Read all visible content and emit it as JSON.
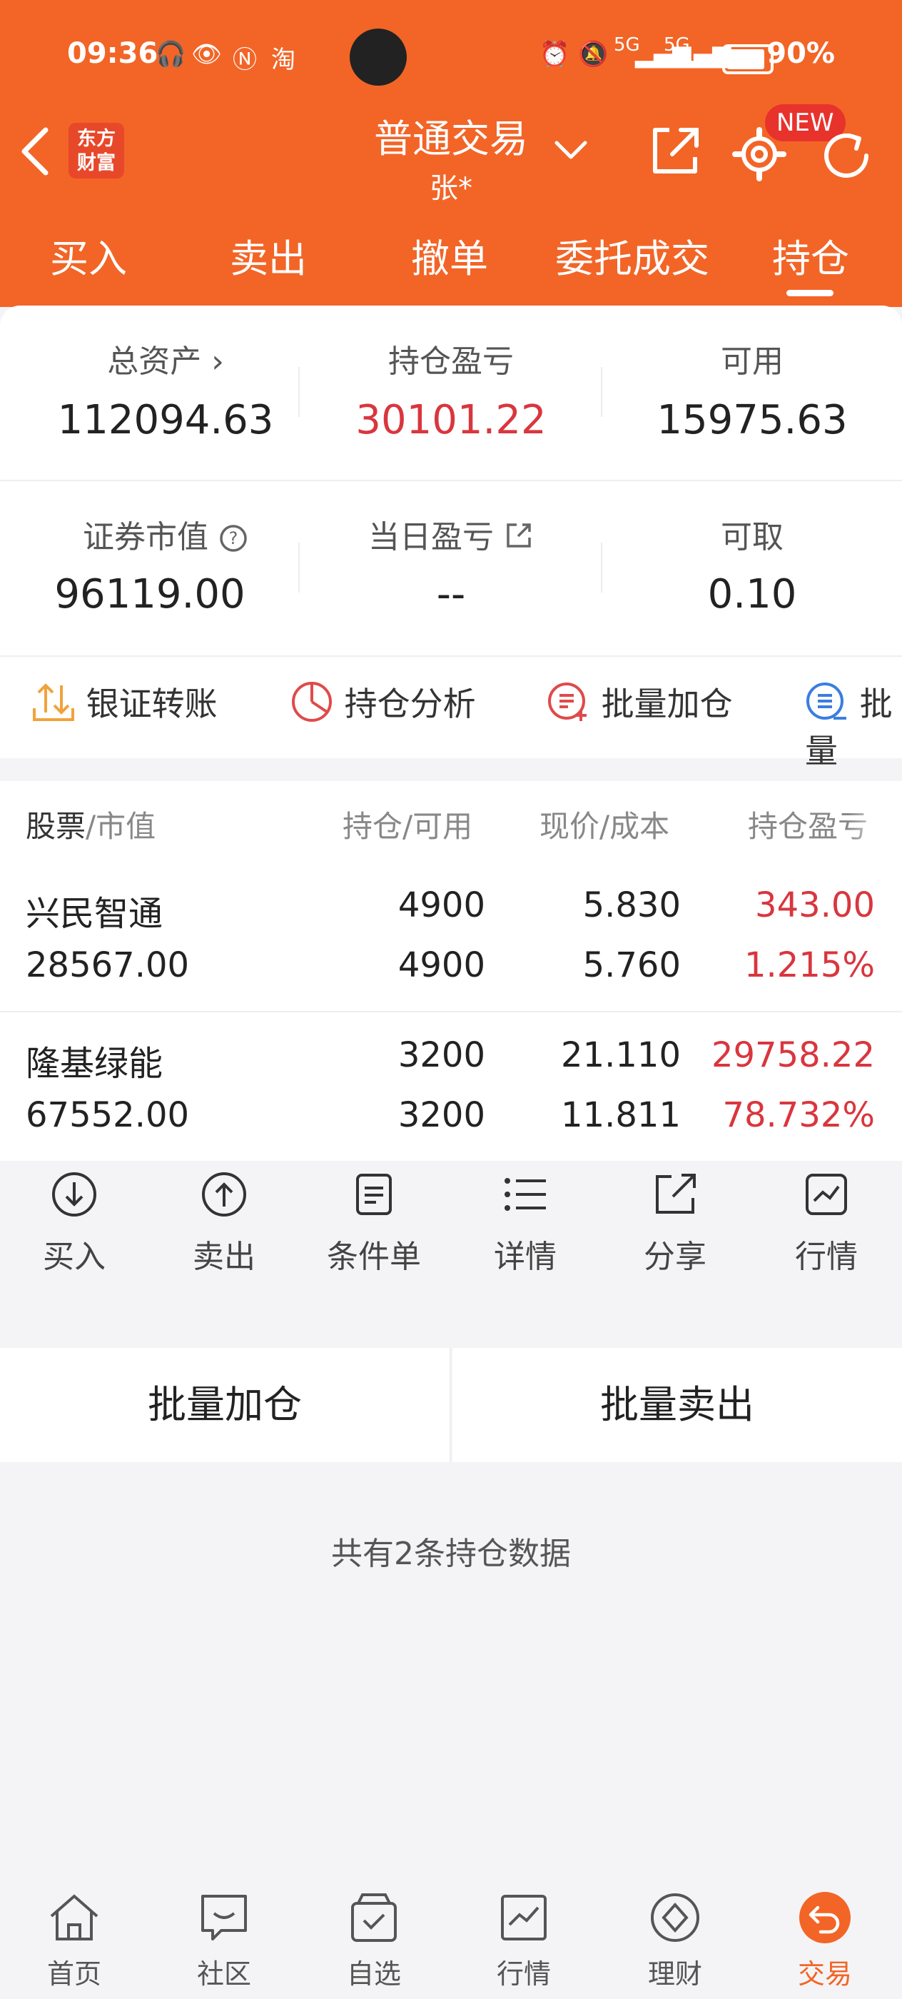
{
  "status_bar": {
    "time": "09:36",
    "battery": "90%",
    "network1": "5G",
    "network2": "5G"
  },
  "navbar": {
    "logo_line1": "东方",
    "logo_line2": "财富",
    "title": "普通交易",
    "subtitle": "张*",
    "badge": "NEW"
  },
  "tabs": [
    {
      "label": "买入"
    },
    {
      "label": "卖出"
    },
    {
      "label": "撤单"
    },
    {
      "label": "委托成交"
    },
    {
      "label": "持仓"
    }
  ],
  "summary": {
    "total_assets_label": "总资产",
    "total_assets": "112094.63",
    "position_pnl_label": "持仓盈亏",
    "position_pnl": "30101.22",
    "available_label": "可用",
    "available": "15975.63",
    "market_value_label": "证券市值",
    "market_value": "96119.00",
    "daily_pnl_label": "当日盈亏",
    "daily_pnl": "--",
    "withdrawable_label": "可取",
    "withdrawable": "0.10"
  },
  "tools": [
    {
      "label": "银证转账"
    },
    {
      "label": "持仓分析"
    },
    {
      "label": "批量加仓"
    },
    {
      "label": "批量"
    }
  ],
  "table": {
    "headers": {
      "stock": "股票",
      "stock_sub": "/市值",
      "holding": "持仓/可用",
      "price": "现价/成本",
      "pnl": "持仓盈亏"
    },
    "rows": [
      {
        "name": "兴民智通",
        "market_value": "28567.00",
        "holding": "4900",
        "available": "4900",
        "price": "5.830",
        "cost": "5.760",
        "pnl": "343.00",
        "pnl_pct": "1.215%"
      },
      {
        "name": "隆基绿能",
        "market_value": "67552.00",
        "holding": "3200",
        "available": "3200",
        "price": "21.110",
        "cost": "11.811",
        "pnl": "29758.22",
        "pnl_pct": "78.732%"
      }
    ]
  },
  "actions": [
    {
      "label": "买入"
    },
    {
      "label": "卖出"
    },
    {
      "label": "条件单"
    },
    {
      "label": "详情"
    },
    {
      "label": "分享"
    },
    {
      "label": "行情"
    }
  ],
  "batch": {
    "add": "批量加仓",
    "sell": "批量卖出"
  },
  "footer_note": "共有2条持仓数据",
  "bottom_nav": [
    {
      "label": "首页"
    },
    {
      "label": "社区"
    },
    {
      "label": "自选"
    },
    {
      "label": "行情"
    },
    {
      "label": "理财"
    },
    {
      "label": "交易"
    }
  ],
  "colors": {
    "brand": "#f26527",
    "loss_gain_red": "#d9363e"
  }
}
